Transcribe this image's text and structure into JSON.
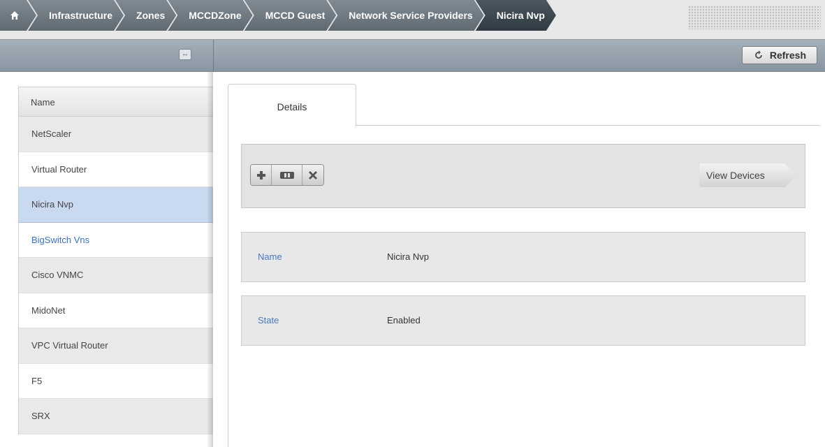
{
  "breadcrumb": {
    "items": [
      "Infrastructure",
      "Zones",
      "MCCDZone",
      "MCCD Guest",
      "Network Service Providers",
      "Nicira Nvp"
    ]
  },
  "toolbar": {
    "refresh_label": "Refresh"
  },
  "list": {
    "header": "Name",
    "items": [
      "NetScaler",
      "Virtual Router",
      "Nicira Nvp",
      "BigSwitch Vns",
      "Cisco VNMC",
      "MidoNet",
      "VPC Virtual Router",
      "F5",
      "SRX"
    ]
  },
  "details": {
    "tab_label": "Details",
    "actions": [
      "plus-icon",
      "ha-icon",
      "remove-icon"
    ],
    "view_devices_label": "View Devices",
    "fields": [
      {
        "key": "Name",
        "value": "Nicira Nvp"
      },
      {
        "key": "State",
        "value": "Enabled"
      }
    ]
  },
  "colors": {
    "breadcrumb": "#6b7680",
    "breadcrumb_active": "#2f3a43",
    "toolbar": "#96a2ac",
    "selected": "#c9daf0",
    "link": "#3f71b6"
  }
}
